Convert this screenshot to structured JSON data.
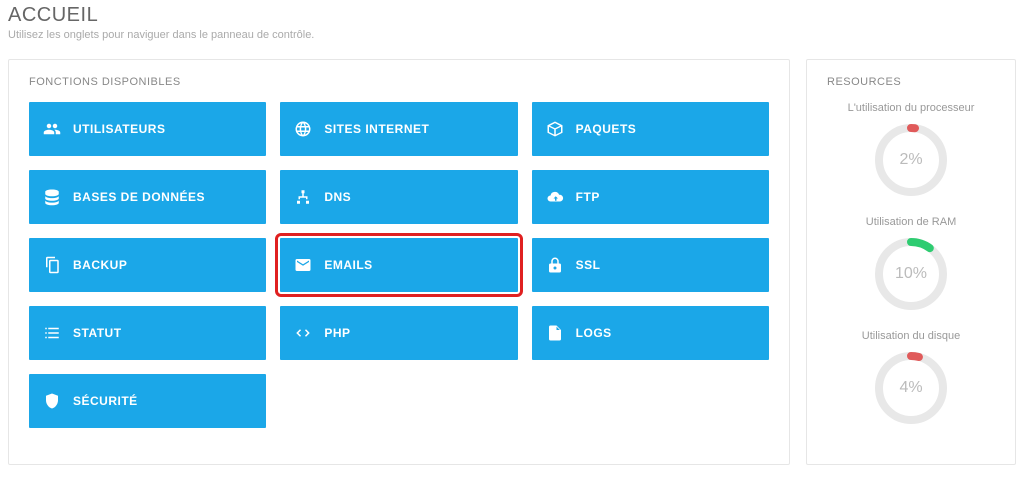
{
  "page": {
    "title": "ACCUEIL",
    "subtitle": "Utilisez les onglets pour naviguer dans le panneau de contrôle."
  },
  "functions": {
    "title": "FONCTIONS DISPONIBLES",
    "tiles": [
      {
        "id": "users",
        "label": "UTILISATEURS",
        "icon": "users-icon",
        "highlighted": false
      },
      {
        "id": "sites",
        "label": "SITES INTERNET",
        "icon": "globe-icon",
        "highlighted": false
      },
      {
        "id": "packages",
        "label": "PAQUETS",
        "icon": "package-icon",
        "highlighted": false
      },
      {
        "id": "db",
        "label": "BASES DE DONNÉES",
        "icon": "database-icon",
        "highlighted": false
      },
      {
        "id": "dns",
        "label": "DNS",
        "icon": "sitemap-icon",
        "highlighted": false
      },
      {
        "id": "ftp",
        "label": "FTP",
        "icon": "cloud-icon",
        "highlighted": false
      },
      {
        "id": "backup",
        "label": "BACKUP",
        "icon": "copy-icon",
        "highlighted": false
      },
      {
        "id": "emails",
        "label": "EMAILS",
        "icon": "envelope-icon",
        "highlighted": true
      },
      {
        "id": "ssl",
        "label": "SSL",
        "icon": "lock-icon",
        "highlighted": false
      },
      {
        "id": "status",
        "label": "STATUT",
        "icon": "list-icon",
        "highlighted": false
      },
      {
        "id": "php",
        "label": "PHP",
        "icon": "code-icon",
        "highlighted": false
      },
      {
        "id": "logs",
        "label": "LOGS",
        "icon": "file-icon",
        "highlighted": false
      },
      {
        "id": "security",
        "label": "SÉCURITÉ",
        "icon": "shield-icon",
        "highlighted": false
      }
    ]
  },
  "resources": {
    "title": "RESOURCES",
    "items": [
      {
        "label": "L'utilisation du processeur",
        "percent": 2,
        "color": "#e05a5a"
      },
      {
        "label": "Utilisation de RAM",
        "percent": 10,
        "color": "#2ecc71"
      },
      {
        "label": "Utilisation du disque",
        "percent": 4,
        "color": "#e05a5a"
      }
    ]
  }
}
